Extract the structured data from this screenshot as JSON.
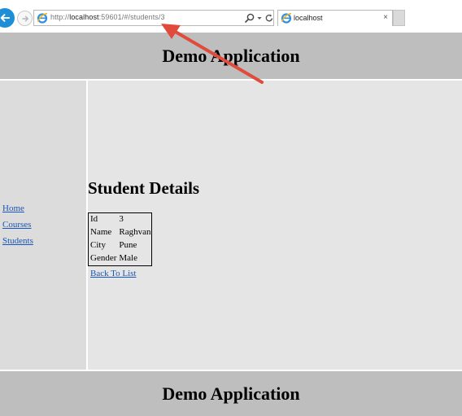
{
  "browser": {
    "url_prefix": "http://",
    "url_host": "localhost",
    "url_rest": ":59601/#/students/3",
    "tab_title": "localhost",
    "tab_close": "×"
  },
  "header": {
    "title": "Demo Application"
  },
  "footer": {
    "title": "Demo Application"
  },
  "sidebar": {
    "items": [
      {
        "label": "Home"
      },
      {
        "label": "Courses"
      },
      {
        "label": "Students"
      }
    ]
  },
  "main": {
    "heading": "Student Details",
    "details": [
      {
        "label": "Id",
        "value": "3"
      },
      {
        "label": "Name",
        "value": "Raghvan"
      },
      {
        "label": "City",
        "value": "Pune"
      },
      {
        "label": "Gender",
        "value": "Male"
      }
    ],
    "back_link": "Back To List"
  },
  "colors": {
    "header_bg": "#bebebe",
    "sidebar_bg": "#dcdcdc",
    "content_bg": "#e5e5e5",
    "link": "#1a56b5",
    "annotation_arrow": "#e04b3c",
    "back_button": "#1e8fd6"
  },
  "icons": [
    "back-arrow-icon",
    "forward-arrow-icon",
    "ie-logo-icon",
    "search-icon",
    "dropdown-icon",
    "refresh-icon",
    "close-icon"
  ]
}
